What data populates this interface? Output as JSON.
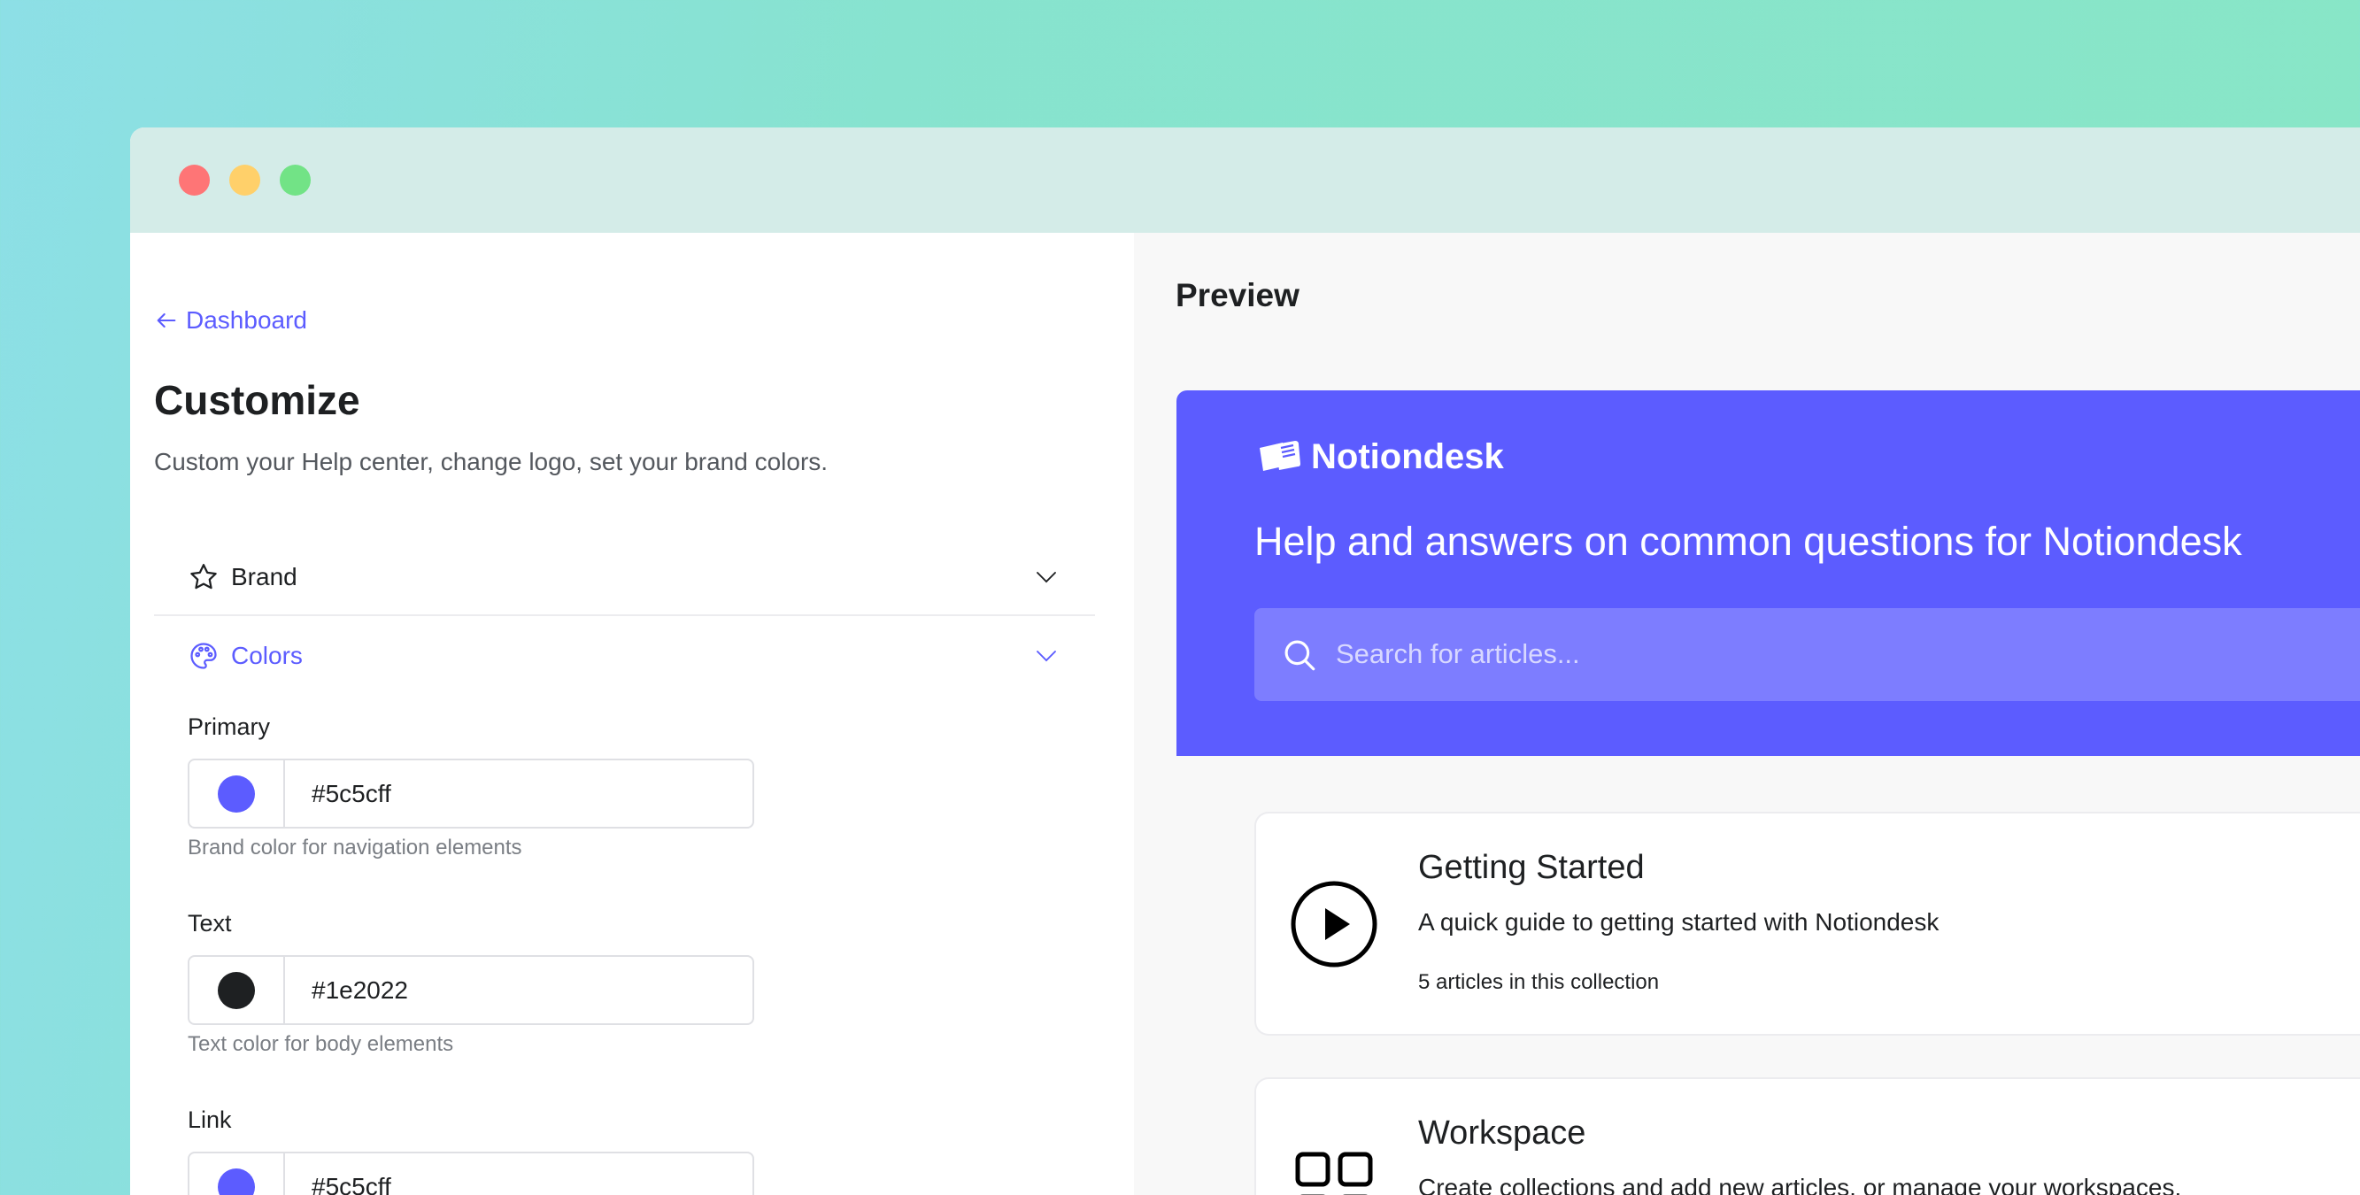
{
  "window": {
    "controls": [
      "close",
      "minimize",
      "maximize"
    ]
  },
  "nav": {
    "back_label": "Dashboard"
  },
  "page": {
    "title": "Customize",
    "subtitle": "Custom your Help center, change logo, set your brand colors."
  },
  "sections": {
    "brand": {
      "label": "Brand",
      "icon": "star-icon"
    },
    "colors": {
      "label": "Colors",
      "icon": "palette-icon"
    }
  },
  "colors": {
    "primary": {
      "label": "Primary",
      "value": "#5c5cff",
      "help": "Brand color for navigation elements"
    },
    "text": {
      "label": "Text",
      "value": "#1e2022",
      "help": "Text color for body elements"
    },
    "link": {
      "label": "Link",
      "value": "#5c5cff"
    }
  },
  "preview": {
    "label": "Preview",
    "brand_name": "Notiondesk",
    "heading": "Help and answers on common questions for Notiondesk",
    "search_placeholder": "Search for articles...",
    "collections": [
      {
        "title": "Getting Started",
        "description": "A quick guide to getting started with Notiondesk",
        "meta": "5 articles in this collection",
        "icon": "play-circle-icon"
      },
      {
        "title": "Workspace",
        "description": "Create collections and add new articles, or manage your workspaces.",
        "icon": "grid-icon"
      }
    ]
  },
  "theme": {
    "accent": "#5c5cff",
    "text": "#1e2022"
  }
}
